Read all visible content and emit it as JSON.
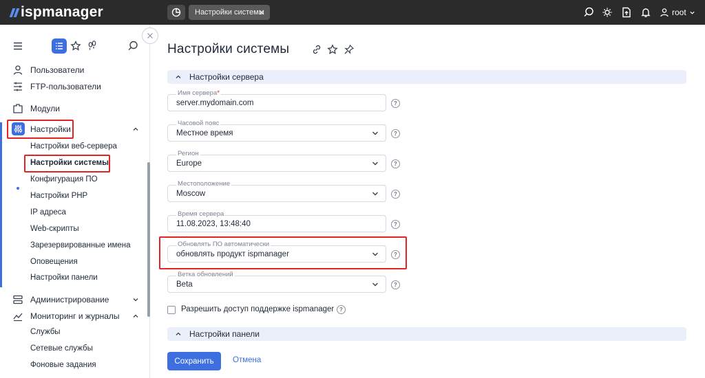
{
  "app": {
    "logo_text": "ispmanager"
  },
  "topbar": {
    "tab_label": "Настройки системы",
    "user_label": "root"
  },
  "sidebar": {
    "items": [
      {
        "label": "Пользователи",
        "icon": "user-icon"
      },
      {
        "label": "FTP-пользователи",
        "icon": "ftp-icon"
      },
      {
        "label": "Модули",
        "icon": "modules-icon"
      },
      {
        "label": "Настройки",
        "icon": "settings-sliders-icon"
      }
    ],
    "settings_sub": [
      "Настройки веб-сервера",
      "Настройки системы",
      "Конфигурация ПО",
      "Настройки PHP",
      "IP адреса",
      "Web-скрипты",
      "Зарезервированные имена",
      "Оповещения",
      "Настройки панели"
    ],
    "admin_label": "Администрирование",
    "monitoring_label": "Мониторинг и журналы",
    "monitoring_sub": [
      "Службы",
      "Сетевые службы",
      "Фоновые задания"
    ]
  },
  "page": {
    "title": "Настройки системы",
    "section_server": "Настройки сервера",
    "section_panel": "Настройки панели",
    "fields": {
      "server_name": {
        "label": "Имя сервера",
        "required_mark": "*",
        "value": "server.mydomain.com"
      },
      "timezone": {
        "label": "Часовой пояс",
        "value": "Местное время"
      },
      "region": {
        "label": "Регион",
        "value": "Europe"
      },
      "location": {
        "label": "Местоположение",
        "value": "Moscow"
      },
      "server_time": {
        "label": "Время сервера",
        "value": "11.08.2023, 13:48:40"
      },
      "auto_update": {
        "label": "Обновлять ПО автоматически",
        "value": "обновлять продукт ispmanager"
      },
      "update_branch": {
        "label": "Ветка обновлений",
        "value": "Beta"
      }
    },
    "support_access_label": "Разрешить доступ поддержке ispmanager",
    "help_glyph": "?",
    "save_label": "Сохранить",
    "cancel_label": "Отмена"
  },
  "colors": {
    "accent": "#3d6fe0",
    "topbar": "#2b2b2b",
    "section_bg": "#ebeffa",
    "highlight": "#e02424"
  }
}
